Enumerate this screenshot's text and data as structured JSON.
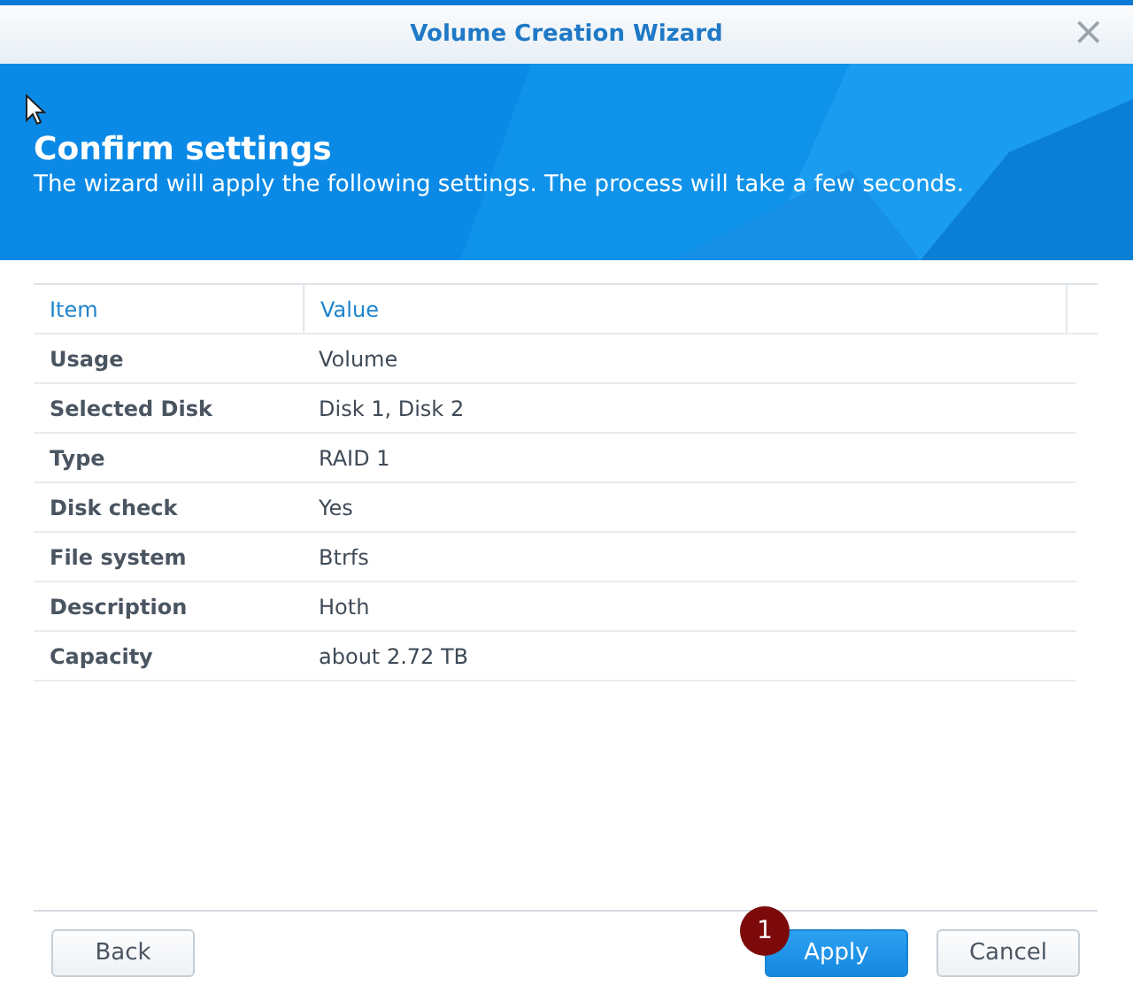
{
  "window": {
    "title": "Volume Creation Wizard",
    "close": "×"
  },
  "banner": {
    "heading": "Confirm settings",
    "description": "The wizard will apply the following settings. The process will take a few seconds."
  },
  "table": {
    "columns": [
      "Item",
      "Value"
    ],
    "rows": [
      {
        "item": "Usage",
        "value": "Volume"
      },
      {
        "item": "Selected Disk",
        "value": "Disk 1, Disk 2"
      },
      {
        "item": "Type",
        "value": "RAID 1"
      },
      {
        "item": "Disk check",
        "value": "Yes"
      },
      {
        "item": "File system",
        "value": "Btrfs"
      },
      {
        "item": "Description",
        "value": "Hoth"
      },
      {
        "item": "Capacity",
        "value": "about 2.72 TB"
      }
    ]
  },
  "buttons": [
    {
      "label": "Back",
      "kind": "default"
    },
    {
      "label": "Apply",
      "kind": "primary",
      "step": "1"
    },
    {
      "label": "Cancel",
      "kind": "default"
    }
  ]
}
